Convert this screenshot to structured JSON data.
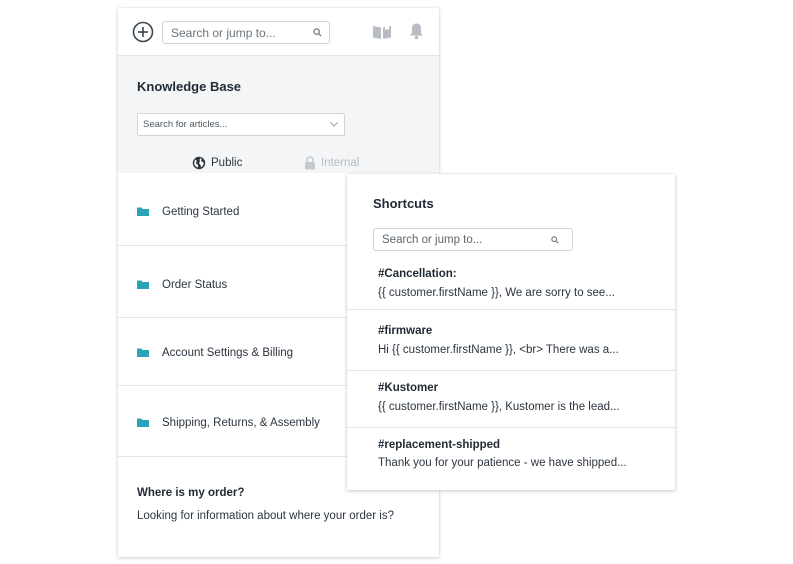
{
  "topbar": {
    "search_placeholder": "Search or jump to...",
    "icons": [
      "add-icon",
      "search-icon",
      "book-icon",
      "bell-icon"
    ]
  },
  "knowledge_base": {
    "title": "Knowledge Base",
    "search_placeholder": "Search for articles...",
    "toggles": {
      "public_label": "Public",
      "internal_label": "Internal"
    },
    "categories": [
      {
        "label": "Getting Started"
      },
      {
        "label": "Order Status"
      },
      {
        "label": "Account Settings & Billing"
      },
      {
        "label": "Shipping, Returns, & Assembly"
      }
    ],
    "faq": {
      "title": "Where is my order?",
      "text": "Looking for information about where your order is?"
    }
  },
  "shortcuts": {
    "title": "Shortcuts",
    "search_placeholder": "Search or jump to...",
    "items": [
      {
        "name": "#Cancellation:",
        "preview": "{{ customer.firstName }}, We are sorry to see..."
      },
      {
        "name": "#firmware",
        "preview": "Hi {{ customer.firstName }}, <br> There was a..."
      },
      {
        "name": "#Kustomer",
        "preview": "{{ customer.firstName }}, Kustomer is the lead..."
      },
      {
        "name": "#replacement-shipped",
        "preview": "Thank you for your patience - we have shipped..."
      }
    ]
  },
  "colors": {
    "folder": "#2ba3b6",
    "header_bg": "#f4f5f6",
    "divider": "#e2e4e7",
    "muted": "#b6bcc2"
  }
}
